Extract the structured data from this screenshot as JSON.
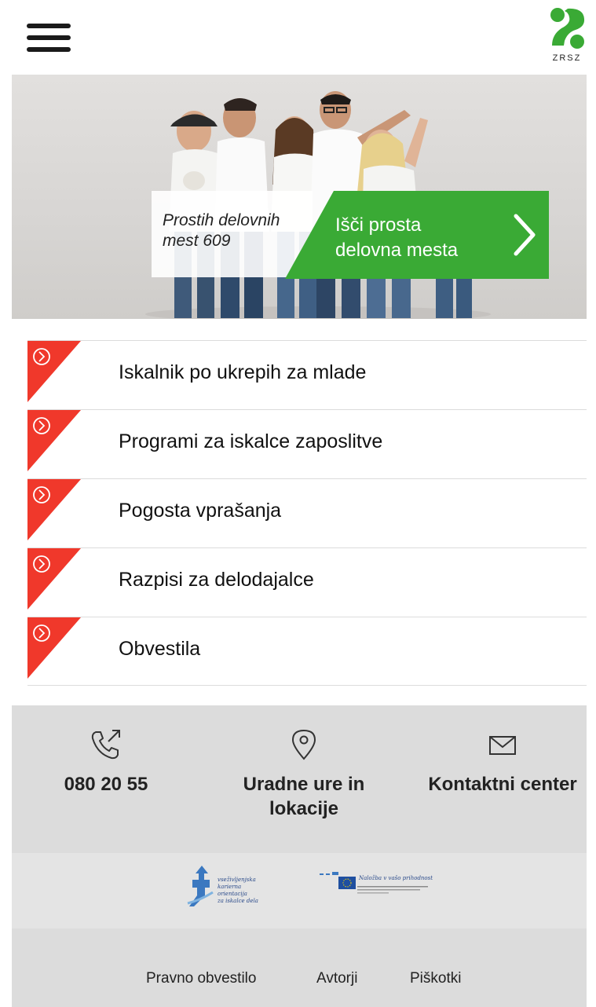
{
  "header": {
    "menu_icon": "hamburger-menu-icon",
    "logo_text": "ZRSZ",
    "logo_color": "#3aaa35"
  },
  "hero": {
    "jobs_count_line1": "Prostih delovnih",
    "jobs_count_line2": "mest 609",
    "search_line1": "Išči prosta",
    "search_line2": "delovna mesta",
    "search_icon": "chevron-right-icon",
    "accent_color": "#3aaa35"
  },
  "menu": {
    "accent_color": "#f0382b",
    "item_icon": "circle-chevron-right-icon",
    "items": [
      {
        "label": "Iskalnik po ukrepih za mlade"
      },
      {
        "label": "Programi za iskalce zaposlitve"
      },
      {
        "label": "Pogosta vprašanja"
      },
      {
        "label": "Razpisi za delodajalce"
      },
      {
        "label": "Obvestila"
      }
    ]
  },
  "contact": {
    "phone_icon": "phone-outgoing-icon",
    "phone": "080 20 55",
    "location_icon": "location-pin-icon",
    "hours_line1": "Uradne ure in",
    "hours_line2": "lokacije",
    "mail_icon": "envelope-icon",
    "contact_center": "Kontaktni center"
  },
  "partners": {
    "left_line1": "vseživljenjska",
    "left_line2": "karierna orientacija",
    "left_line3": "za iskalce dela",
    "right_line1": "Naložba v vašo prihodnost"
  },
  "footer": {
    "legal": "Pravno obvestilo",
    "authors": "Avtorji",
    "cookies": "Piškotki"
  }
}
